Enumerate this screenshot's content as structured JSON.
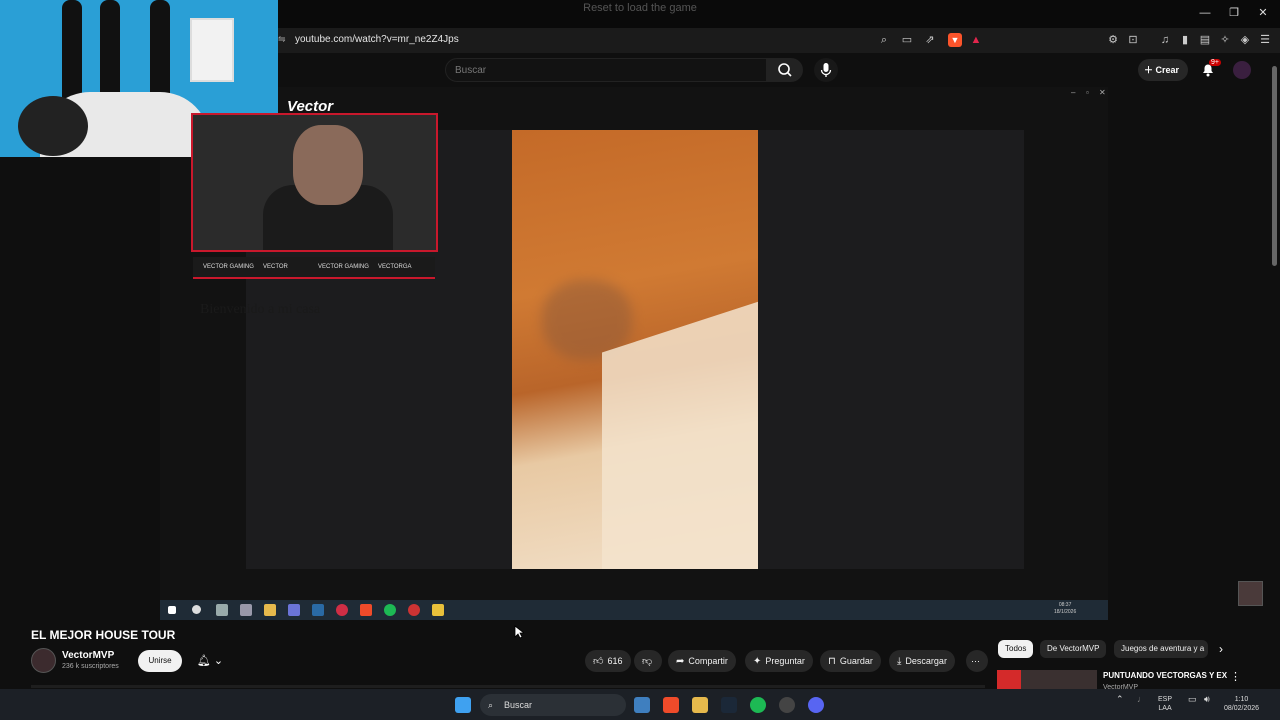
{
  "browser": {
    "window_title": "Reset to load the game",
    "url": "youtube.com/watch?v=mr_ne2Z4Jps"
  },
  "header": {
    "search_placeholder": "Buscar",
    "create_label": "Crear",
    "notif_count": "9+"
  },
  "stream_overlay": {
    "brand": "Vector",
    "socials": [
      "VECTOR GAMING",
      "VECTOR",
      "VECTOR GAMING",
      "VECTORGA"
    ],
    "faded_text": "Bienvenido a mi casa"
  },
  "inner_clock": {
    "time": "08:37",
    "date": "18/1/2026"
  },
  "video": {
    "title": "EL MEJOR HOUSE TOUR",
    "channel": "VectorMVP",
    "subscribers": "236 k suscriptores",
    "join_label": "Unirse",
    "likes": "616",
    "share_label": "Compartir",
    "ask_label": "Preguntar",
    "save_label": "Guardar",
    "download_label": "Descargar"
  },
  "chips": [
    "Todos",
    "De VectorMVP",
    "Juegos de aventura y a"
  ],
  "recommended": {
    "title": "PUNTUANDO VECTORGAS Y EX",
    "channel": "VectorMVP"
  },
  "taskbar": {
    "search_label": "Buscar",
    "lang_top": "ESP",
    "lang_bottom": "LAA",
    "time": "1:10",
    "date": "08/02/2026"
  },
  "colors": {
    "accent_red": "#c9182c",
    "yt_bg": "#0f0f0f"
  }
}
